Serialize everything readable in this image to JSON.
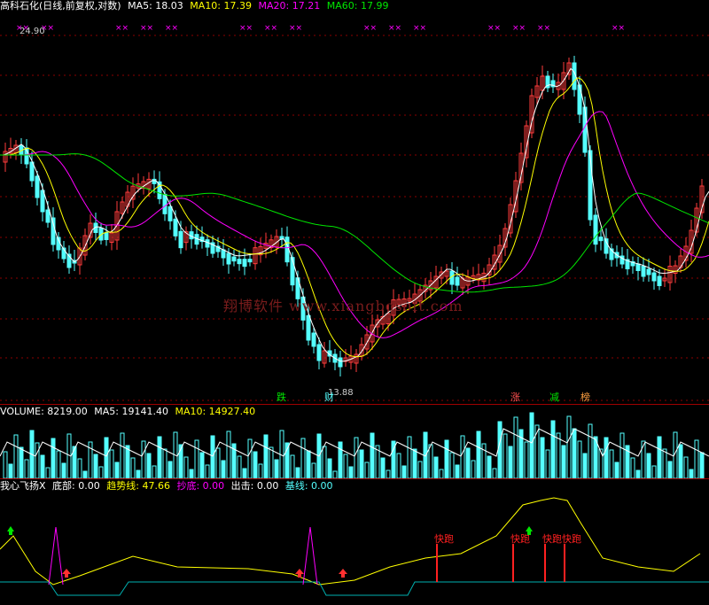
{
  "main_header": {
    "title": "高科石化(日线,前复权,对数)",
    "ma5": "MA5: 18.03",
    "ma10": "MA10: 17.39",
    "ma20": "MA20: 17.21",
    "ma60": "MA60: 17.99"
  },
  "volume_header": {
    "volume": "VOLUME: 8219.00",
    "ma5": "MA5: 19141.40",
    "ma10": "MA10: 14927.40"
  },
  "indicator_header": {
    "name": "我心飞扬X",
    "bottom": "底部: 0.00",
    "trend": "趋势线: 47.66",
    "copy_bottom": "抄底: 0.00",
    "exit": "出击: 0.00",
    "base": "基线: 0.00"
  },
  "annotations": {
    "high": "24.90",
    "low": "13.88"
  },
  "signals": {
    "fall": "跌",
    "wealth": "财",
    "rise": "涨",
    "reduce": "减",
    "board": "榜"
  },
  "run_labels": [
    "快跑",
    "快跑",
    "快跑",
    "快跑"
  ],
  "watermark": "翔博软件 www.xiangbosoft.com",
  "colors": {
    "up": "#ff3c3c",
    "down": "#54ffff",
    "ma5": "#ffffff",
    "ma10": "#ffff00",
    "ma20": "#ff00ff",
    "ma60": "#00e600",
    "trend": "#ffff00",
    "base": "#00b0b0"
  },
  "chart_data": {
    "type": "candlestick",
    "price_range": [
      13.88,
      24.9
    ],
    "series": []
  }
}
